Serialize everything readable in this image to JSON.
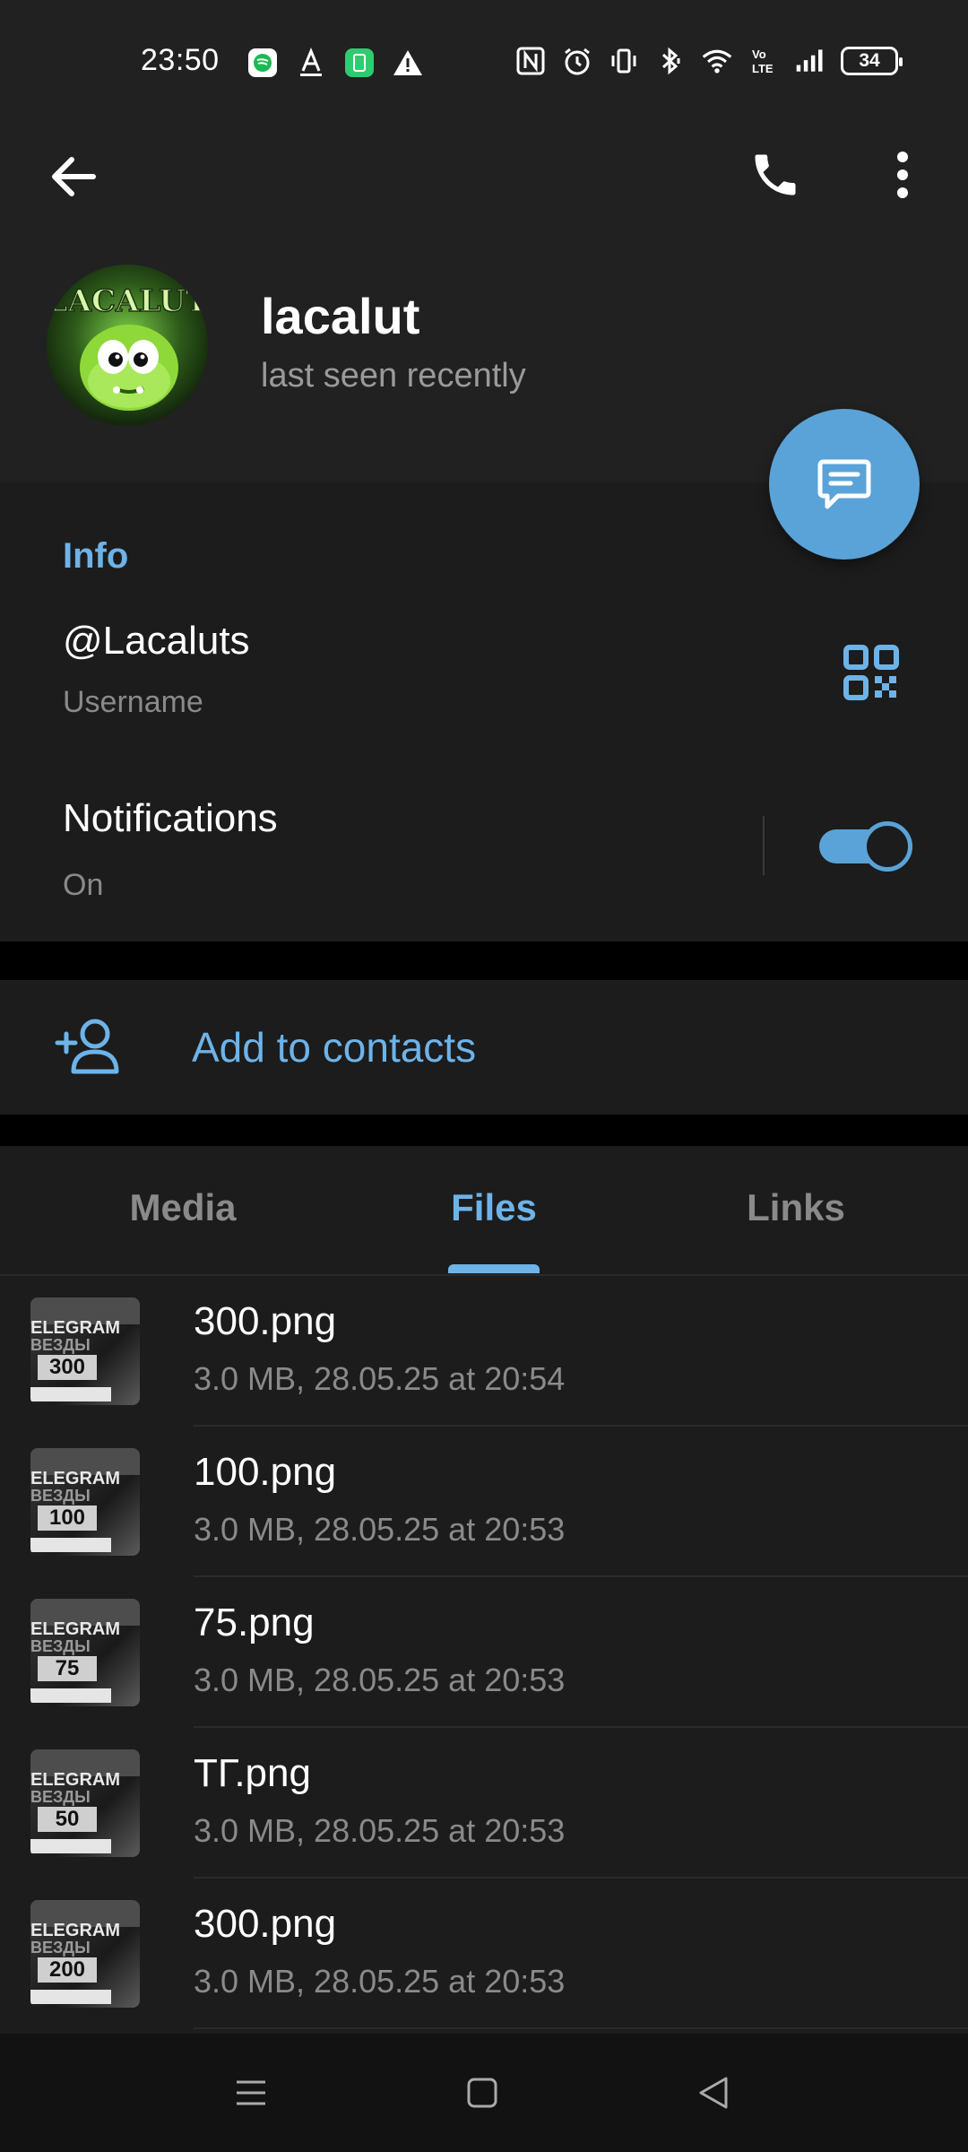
{
  "status_bar": {
    "time": "23:50",
    "battery": "34",
    "left_icons": [
      "spotify-icon",
      "font-a-icon",
      "green-app-icon",
      "warning-icon"
    ],
    "right_icons": [
      "nfc-icon",
      "alarm-icon",
      "vibrate-icon",
      "bluetooth-icon",
      "wifi-icon",
      "volte-icon",
      "signal-icon"
    ]
  },
  "header": {
    "name": "lacalut",
    "status": "last seen recently"
  },
  "info": {
    "title": "Info",
    "username": "@Lacaluts",
    "username_label": "Username",
    "notifications_title": "Notifications",
    "notifications_value": "On",
    "notifications_enabled": true
  },
  "actions": {
    "add_contacts": "Add to contacts"
  },
  "tabs": [
    {
      "label": "Media",
      "active": false
    },
    {
      "label": "Files",
      "active": true
    },
    {
      "label": "Links",
      "active": false
    }
  ],
  "files": [
    {
      "name": "300.png",
      "meta": "3.0 MB, 28.05.25 at 20:54",
      "thumb_num": "300"
    },
    {
      "name": "100.png",
      "meta": "3.0 MB, 28.05.25 at 20:53",
      "thumb_num": "100"
    },
    {
      "name": "75.png",
      "meta": "3.0 MB, 28.05.25 at 20:53",
      "thumb_num": "75"
    },
    {
      "name": "ТГ.png",
      "meta": "3.0 MB, 28.05.25 at 20:53",
      "thumb_num": "50"
    },
    {
      "name": "300.png",
      "meta": "3.0 MB, 28.05.25 at 20:53",
      "thumb_num": "200"
    }
  ],
  "thumb_text": {
    "line1": "ELEGRAM",
    "line2": "ВЕЗДЫ"
  },
  "avatar_text": "LACALUT",
  "colors": {
    "accent": "#6eb3e8",
    "fab": "#5aa3d8",
    "header_bg": "#212121",
    "section_bg": "#1c1c1c"
  }
}
